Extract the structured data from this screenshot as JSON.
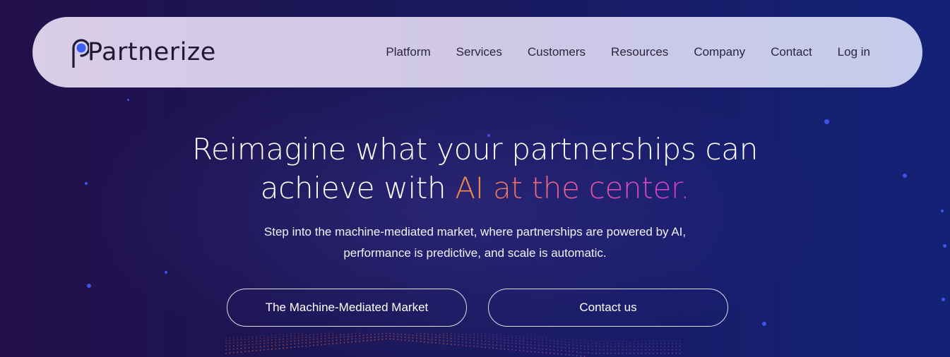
{
  "brand": {
    "name": "Partnerize",
    "mark_color": "#3b5ef0"
  },
  "nav": {
    "items": [
      {
        "label": "Platform"
      },
      {
        "label": "Services"
      },
      {
        "label": "Customers"
      },
      {
        "label": "Resources"
      },
      {
        "label": "Company"
      },
      {
        "label": "Contact"
      },
      {
        "label": "Log in"
      }
    ]
  },
  "hero": {
    "title_line1": "Reimagine what your partnerships can",
    "title_line2_prefix": "achieve with ",
    "title_line2_ai": "AI",
    "title_line2_suffix": " at the center.",
    "subtitle_line1": "Step into the machine-mediated market, where partnerships are powered by AI,",
    "subtitle_line2": "performance is predictive, and scale is automatic."
  },
  "cta": {
    "primary_label": "The Machine-Mediated Market",
    "secondary_label": "Contact us"
  },
  "colors": {
    "accent_orange": "#f0874a",
    "accent_pink": "#e9589a",
    "accent_purple": "#c93be0",
    "background_dark": "#1b1656"
  }
}
